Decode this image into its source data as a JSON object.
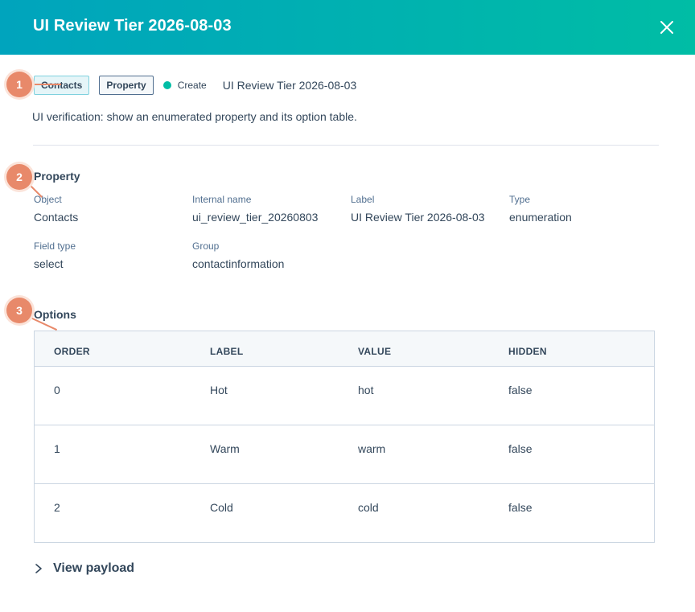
{
  "modal": {
    "title": "UI Review Tier 2026-08-03",
    "close_icon": "close-icon"
  },
  "tags": {
    "object_tag": "Contacts",
    "type_tag": "Property",
    "status": "Create",
    "status_color": "#00bda5",
    "name": "UI Review Tier 2026-08-03"
  },
  "description": "UI verification: show an enumerated property and its option table.",
  "property": {
    "title": "Property",
    "object_label": "Object",
    "object_value": "Contacts",
    "internal_name_label": "Internal name",
    "internal_name_value": "ui_review_tier_20260803",
    "label_label": "Label",
    "label_value": "UI Review Tier 2026-08-03",
    "type_label": "Type",
    "type_value": "enumeration",
    "field_type_label": "Field type",
    "field_type_value": "select",
    "group_label": "Group",
    "group_value": "contactinformation"
  },
  "options": {
    "title": "Options",
    "columns": [
      "ORDER",
      "LABEL",
      "VALUE",
      "HIDDEN"
    ],
    "rows": [
      [
        "0",
        "Hot",
        "hot",
        "false"
      ],
      [
        "1",
        "Warm",
        "warm",
        "false"
      ],
      [
        "2",
        "Cold",
        "cold",
        "false"
      ]
    ]
  },
  "view_payload": "View payload",
  "callouts": [
    "1",
    "2",
    "3"
  ],
  "colors": {
    "header_gradient_start": "#00a4bd",
    "header_gradient_end": "#00bda5",
    "callout": "#e8896a"
  }
}
